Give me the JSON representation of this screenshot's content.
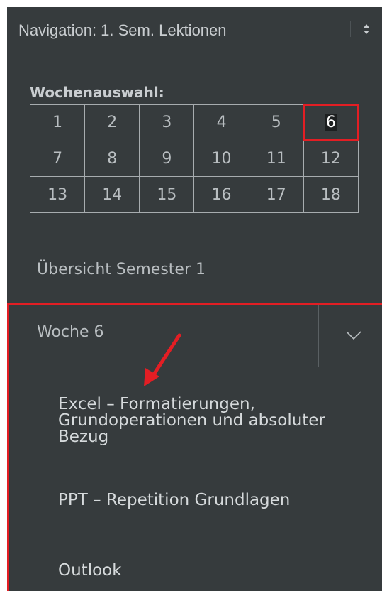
{
  "navigation": {
    "label": "Navigation: 1. Sem. Lektionen",
    "icon": "sort-arrows-icon"
  },
  "week_selector": {
    "heading": "Wochenauswahl:",
    "weeks": [
      "1",
      "2",
      "3",
      "4",
      "5",
      "6",
      "7",
      "8",
      "9",
      "10",
      "11",
      "12",
      "13",
      "14",
      "15",
      "16",
      "17",
      "18"
    ],
    "current": "6"
  },
  "overview_link": "Übersicht Semester 1",
  "week_section": {
    "title": "Woche 6",
    "toggle_icon": "chevron-down-icon",
    "lessons": [
      "Excel – Formatierungen, Grundoperationen und absoluter Bezug",
      "PPT – Repetition Grundlagen",
      "Outlook"
    ]
  },
  "colors": {
    "panel": "#363b3d",
    "highlight": "#e31e24",
    "text": "#c9cdd0"
  }
}
